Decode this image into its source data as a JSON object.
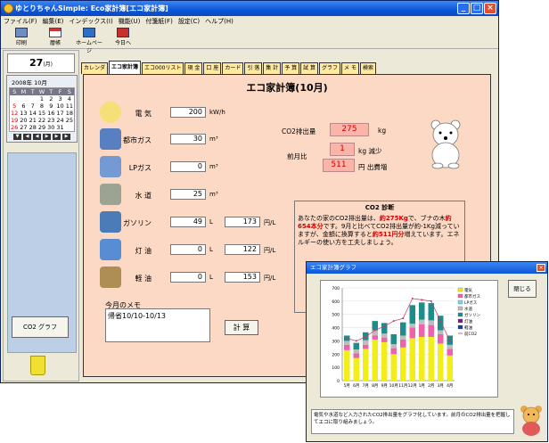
{
  "window": {
    "title": "ゆとりちゃんSimple: Eco家計簿[エコ家計簿]"
  },
  "menu": [
    "ファイル(F)",
    "編集(E)",
    "インデックス(I)",
    "機能(U)",
    "付箋紙(F)",
    "設定(C)",
    "ヘルプ(H)"
  ],
  "toolbar": [
    "印刷",
    "暦帳",
    "ホームページ",
    "今日へ"
  ],
  "sidebar": {
    "date_day": "27",
    "date_dow": "(月)",
    "cal_title": "2008年 10月",
    "cal_head": [
      "S",
      "M",
      "T",
      "W",
      "T",
      "F",
      "S"
    ],
    "cal_days": [
      "",
      "",
      "",
      "1",
      "2",
      "3",
      "4",
      "5",
      "6",
      "7",
      "8",
      "9",
      "10",
      "11",
      "12",
      "13",
      "14",
      "15",
      "16",
      "17",
      "18",
      "19",
      "20",
      "21",
      "22",
      "23",
      "24",
      "25",
      "26",
      "27",
      "28",
      "29",
      "30",
      "31",
      ""
    ],
    "cal_nav": [
      "▼",
      "◀",
      "◀",
      "▶",
      "▶",
      "▶"
    ],
    "co2_button": "CO2 グラフ"
  },
  "tabs": [
    "カレンダ",
    "エコ家計簿",
    "エコ000リスト",
    "現 金",
    "口 座",
    "カード",
    "引 落",
    "集 計",
    "予 算",
    "試 算",
    "グラフ",
    "メ モ",
    "検索"
  ],
  "page": {
    "title": "エコ家計簿(10月)",
    "rows": [
      {
        "label": "電 気",
        "value": "200",
        "unit": "kW/h"
      },
      {
        "label": "都市ガス",
        "value": "30",
        "unit": "m³"
      },
      {
        "label": "LPガス",
        "value": "0",
        "unit": "m³"
      },
      {
        "label": "水 道",
        "value": "25",
        "unit": "m³"
      },
      {
        "label": "ガソリン",
        "value": "49",
        "unit": "L",
        "price": "173",
        "price_unit": "円/L"
      },
      {
        "label": "灯 油",
        "value": "0",
        "unit": "L",
        "price": "122",
        "price_unit": "円/L"
      },
      {
        "label": "軽 油",
        "value": "0",
        "unit": "L",
        "price": "153",
        "price_unit": "円/L"
      }
    ],
    "co2": {
      "label": "CO2排出量",
      "value": "275",
      "unit": "kg",
      "prev_label": "前月比",
      "diff_kg": "1",
      "diff_kg_unit": "kg 減少",
      "diff_yen": "511",
      "diff_yen_unit": "円 出費増"
    },
    "memo_label": "今月のメモ",
    "memo_text": "帰省10/10-10/13",
    "calc_button": "計 算",
    "diagnosis": {
      "title": "CO2 診断",
      "t1": "あなたの家のCO2排出量は、",
      "t2": "約275Kg",
      "t3": "で、ブナの木",
      "t4": "約654本分",
      "t5": "です。9月と比べてCO2排出量が約-1Kg減っていますが、金額に換算すると",
      "t6": "約511円分",
      "t7": "増えています。エネルギーの使い方を工夫しましょう。"
    }
  },
  "graph_window": {
    "title": "エコ家計簿グラフ",
    "close_button": "閉じる",
    "message": "電気や水道など入力されたCO2排出量をグラフ化しています。前月のCO2排出量を把握してエコに取り組みましょう。"
  },
  "chart_data": {
    "type": "bar",
    "categories": [
      "5月",
      "6月",
      "7月",
      "8月",
      "9月",
      "10月",
      "11月",
      "12月",
      "1月",
      "2月",
      "3月",
      "4月"
    ],
    "yticks": [
      "0",
      "100",
      "200",
      "300",
      "400",
      "500",
      "600",
      "700"
    ],
    "ylim": [
      0,
      700
    ],
    "series": [
      {
        "name": "電気",
        "color": "#f2ee1a",
        "values": [
          230,
          170,
          240,
          310,
          290,
          200,
          250,
          320,
          330,
          330,
          280,
          190
        ]
      },
      {
        "name": "都市ガス",
        "color": "#ed62a9",
        "values": [
          40,
          35,
          30,
          30,
          35,
          45,
          60,
          80,
          95,
          90,
          70,
          50
        ]
      },
      {
        "name": "LPガス",
        "color": "#7fd3f0",
        "values": [
          0,
          0,
          0,
          0,
          0,
          0,
          0,
          0,
          0,
          0,
          0,
          0
        ]
      },
      {
        "name": "水道",
        "color": "#bdbdbd",
        "values": [
          30,
          30,
          35,
          40,
          30,
          30,
          30,
          30,
          35,
          35,
          30,
          30
        ]
      },
      {
        "name": "ガソリン",
        "color": "#1f8c8c",
        "values": [
          40,
          50,
          60,
          70,
          80,
          75,
          100,
          140,
          130,
          130,
          110,
          70
        ]
      },
      {
        "name": "灯油",
        "color": "#7a1f6e",
        "values": [
          0,
          0,
          0,
          0,
          0,
          0,
          0,
          0,
          0,
          0,
          0,
          0
        ]
      },
      {
        "name": "軽油",
        "color": "#1a3aa8",
        "values": [
          0,
          0,
          0,
          0,
          0,
          0,
          0,
          0,
          0,
          0,
          0,
          0
        ]
      }
    ],
    "line": {
      "name": "前CO2",
      "color": "#cc3366",
      "values": [
        320,
        300,
        330,
        380,
        410,
        450,
        470,
        620,
        610,
        600,
        450,
        300
      ]
    }
  }
}
